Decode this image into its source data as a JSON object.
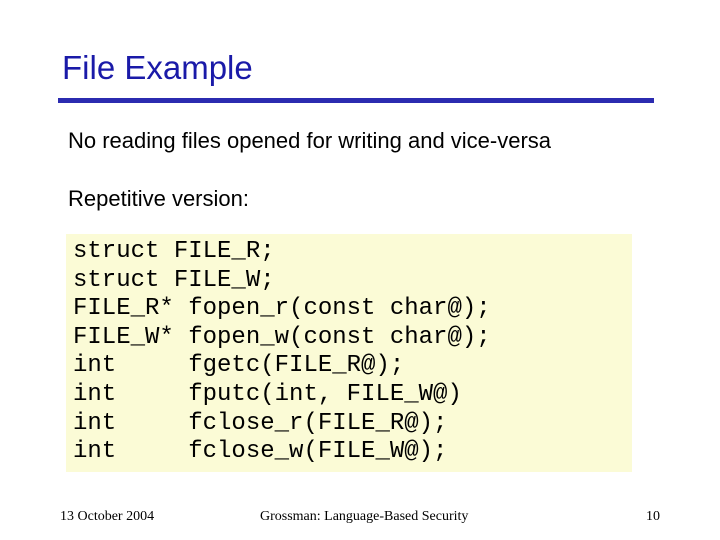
{
  "slide": {
    "title": "File Example",
    "paragraphs": [
      "No reading files opened for writing and vice-versa",
      "Repetitive version:"
    ],
    "code_lines": [
      "struct FILE_R;",
      "struct FILE_W;",
      "FILE_R* fopen_r(const char@);",
      "FILE_W* fopen_w(const char@);",
      "int     fgetc(FILE_R@);",
      "int     fputc(int, FILE_W@)",
      "int     fclose_r(FILE_R@);",
      "int     fclose_w(FILE_W@);"
    ],
    "colors": {
      "title": "#1a1aa8",
      "rule": "#2b2bb0",
      "code_background": "#fbfbd6"
    }
  },
  "footer": {
    "date": "13 October 2004",
    "center": "Grossman: Language-Based Security",
    "page": "10"
  }
}
